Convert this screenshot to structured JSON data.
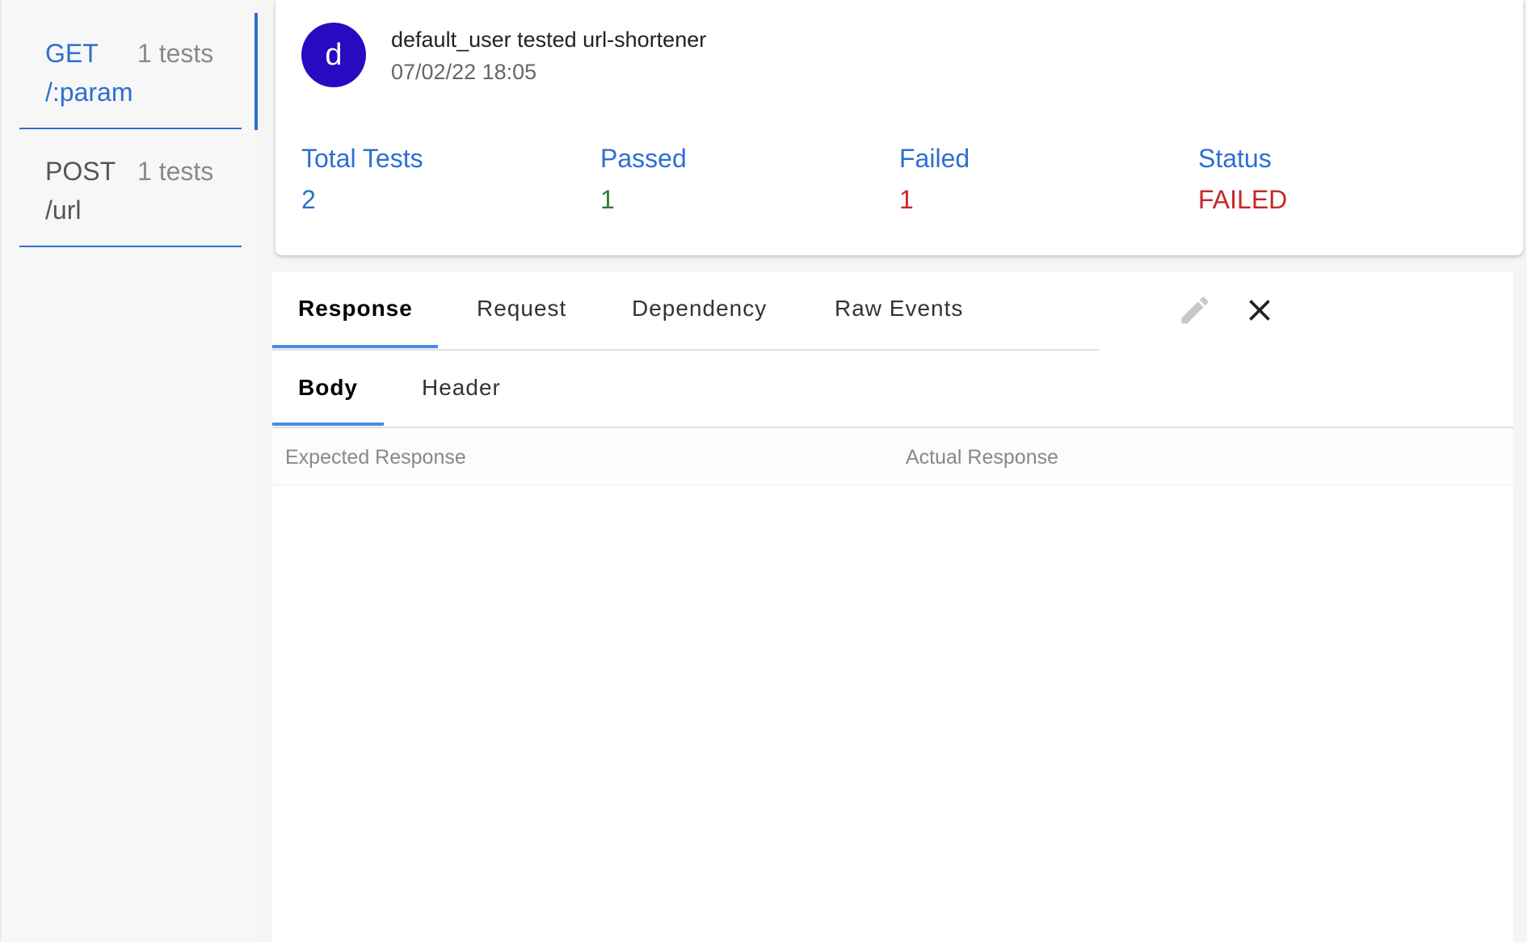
{
  "sidebar": {
    "items": [
      {
        "method": "GET",
        "count": "1 tests",
        "path": "/:param",
        "active": true
      },
      {
        "method": "POST",
        "count": "1 tests",
        "path": "/url",
        "active": false
      }
    ]
  },
  "summary": {
    "avatar_letter": "d",
    "headline": "default_user tested url-shortener",
    "timestamp": "07/02/22 18:05",
    "stats": [
      {
        "label": "Total Tests",
        "value": "2"
      },
      {
        "label": "Passed",
        "value": "1"
      },
      {
        "label": "Failed",
        "value": "1"
      },
      {
        "label": "Status",
        "value": "FAILED"
      }
    ]
  },
  "detail": {
    "tabs": [
      "Response",
      "Request",
      "Dependency",
      "Raw Events"
    ],
    "active_tab": "Response",
    "subtabs": [
      "Body",
      "Header"
    ],
    "active_subtab": "Body",
    "columns": [
      "Expected Response",
      "Actual Response"
    ],
    "icons": {
      "edit": "pencil-icon",
      "close": "close-icon"
    }
  },
  "colors": {
    "accent": "#2d6fd1",
    "avatar": "#2a0ac0",
    "passed": "#2e7d32",
    "failed": "#c62828",
    "tab_underline": "#4a8ae8"
  }
}
